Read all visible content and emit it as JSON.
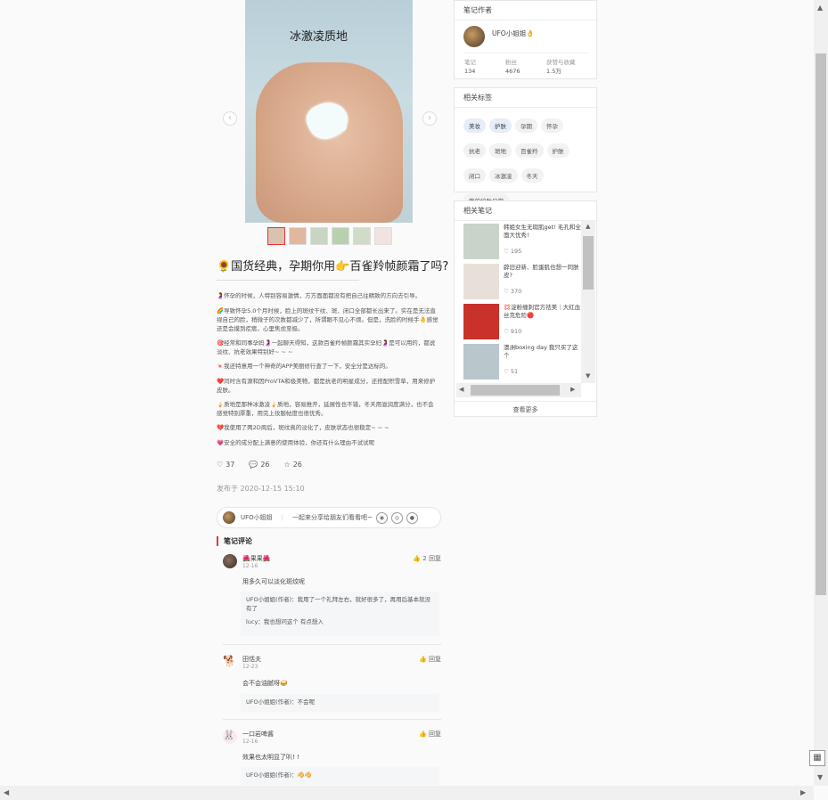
{
  "post": {
    "image_caption": "冰激凌质地",
    "thumb_count": 6,
    "title": "🌻国货经典，孕期你用👉百雀羚帧颜霜了吗?",
    "paragraphs": [
      "🤰怀孕的时候，人特别容易激情，方方面面都没有把自己往精致的方向去引导。",
      "🌈导致怀孕5.0个月时候，脸上的斑纹干纹、斑、闭口全部都长出来了。实在是无法直视自己的脸，稍微子的次数都减少了，所谓眼不见心不烦。但是，洗脸的时候手🤚感觉还是会摸到疙瘩，心里焦虑至极。",
      "🎯经常和同事孕妈🤰一起聊天得知，这款百雀羚帧颜霜其实孕妇🤰是可以用的，都说淡纹、抗老效果特别好~ ~ ~",
      "🍬我还特意用一个神奇的APP美丽修行查了一下，安全分是达标的。",
      "❤️同时含有源和因ProVTA和极美物，都是抗老的明星成分，还搭配积雪草，用来修护皮肤。",
      "🍦质地是那种冰激凌🍦质地，容易推开，延展性也不错，冬天用滋润度满分，也不会感觉特别厚重，用完上妆服帖度也很优秀。",
      "💔我使用了两2D周后，斑纹真的淡化了，皮肤状态也很稳定~ ~ ~",
      "💗安全的成分配上满意的使用体验，你还有什么理由不试试呢"
    ],
    "likes": "37",
    "comments": "26",
    "collects": "26",
    "published": "发布于 2020-12-15 15:10",
    "author_name": "UFO小姐姐",
    "share_text": "一起来分享给朋友们看看吧~"
  },
  "comments_section": {
    "title": "笔记评论",
    "comments": [
      {
        "name": "🌺果果🌺",
        "date": "12-16",
        "likes": "2",
        "reply_label": "回复",
        "text": "用多久可以淡化斑纹呢",
        "replies": [
          "UFO小姐姐(作者)：我用了一个礼拜左右，就好很多了，再用后基本就没有了",
          "lucy：我也想问这个 有点想入"
        ]
      },
      {
        "name": "田恬夫",
        "date": "12-23",
        "likes": "",
        "reply_label": "回复",
        "text": "会不会油腻呀🥪",
        "replies": [
          "UFO小姐姐(作者)：不会呢"
        ]
      },
      {
        "name": "一口岩啤酱",
        "date": "12-16",
        "likes": "",
        "reply_label": "回复",
        "text": "效果也太明显了叭! !",
        "replies": [
          "UFO小姐姐(作者)：🥠🥠"
        ]
      }
    ]
  },
  "sidebar": {
    "author_card": {
      "title": "笔记作者",
      "name": "UFO小姐姐👌",
      "stats": [
        {
          "label": "笔记",
          "value": "134"
        },
        {
          "label": "粉丝",
          "value": "4676"
        },
        {
          "label": "获赞与收藏",
          "value": "1.5万"
        }
      ]
    },
    "tags_card": {
      "title": "相关标签",
      "tags": [
        "美妆",
        "护肤",
        "孕期",
        "怀孕",
        "抗老",
        "斑地",
        "百雀羚",
        "护肤",
        "闭口",
        "冰激凌",
        "冬天",
        "我的护肤日常"
      ],
      "highlighted": [
        0,
        1
      ]
    },
    "notes_card": {
      "title": "相关笔记",
      "notes": [
        {
          "title": "韩姐女生无瑕肌get! 毛孔和全面大优秀!",
          "likes": "195",
          "color": "#c9d3c9"
        },
        {
          "title": "辟旧迎新、脸蛋肌也想一同肤皮?",
          "likes": "370",
          "color": "#e8e0d8"
        },
        {
          "title": "💢淀粉缠刺官方祛美｜大红血丝克危险🔴",
          "likes": "910",
          "color": "#c8322a"
        },
        {
          "title": "澳洲boxing day 我只买了这个",
          "likes": "51",
          "color": "#b9c6cc"
        }
      ],
      "more": "查看更多"
    }
  }
}
